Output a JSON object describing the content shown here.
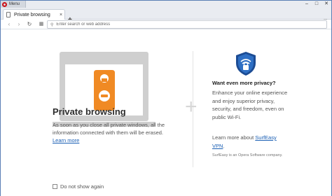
{
  "titlebar": {
    "menu_label": "Menu",
    "controls": [
      "–",
      "□",
      "✕"
    ]
  },
  "tabs": [
    {
      "title": "Private browsing",
      "close": "×"
    }
  ],
  "tabbar": {
    "new_tab": "+",
    "tab_menu": "⩸"
  },
  "toolbar": {
    "back": "‹",
    "forward": "›",
    "reload": "↻",
    "speed_dial": "▦",
    "address_placeholder": "Enter search or web address"
  },
  "private": {
    "title": "Private browsing",
    "description": "As soon as you close all private windows, all the information connected with them will be erased.",
    "learn_more": "Learn more"
  },
  "vpn": {
    "title": "Want even more privacy?",
    "description": "Enhance your online experience and enjoy superior privacy, security, and freedom, even on public Wi-Fi.",
    "learn_prefix": "Learn more about ",
    "link": "SurfEasy VPN",
    "learn_suffix": ".",
    "note": "SurfEasy is an Opera Software company."
  },
  "dont_show": {
    "label": "Do not show again",
    "checked": false
  },
  "colors": {
    "accent": "#1a5fb4",
    "opera_red": "#cc0f16",
    "hanger_orange": "#f08a24",
    "shield_blue": "#1c4c94"
  }
}
